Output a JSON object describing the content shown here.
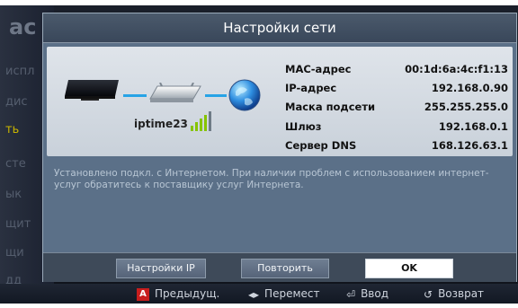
{
  "dialog": {
    "title": "Настройки сети",
    "device_name": "iptime23",
    "signal_bars": 4,
    "message": "Установлено подкл. с Интернетом. При наличии проблем с использованием интернет-услуг обратитесь к поставщику услуг Интернета.",
    "info": [
      {
        "key": "МАС-адрес",
        "value": "00:1d:6a:4c:f1:13"
      },
      {
        "key": "IP-адрес",
        "value": "192.168.0.90"
      },
      {
        "key": "Маска подсети",
        "value": "255.255.255.0"
      },
      {
        "key": "Шлюз",
        "value": "192.168.0.1"
      },
      {
        "key": "Сервер DNS",
        "value": "168.126.63.1"
      }
    ],
    "buttons": {
      "ip_settings": "Настройки IP",
      "retry": "Повторить",
      "ok": "OK"
    }
  },
  "background_menu": {
    "title_fragment": "ас",
    "items": [
      "испл",
      "дис",
      "ть",
      "сте",
      "ык",
      "щит",
      "щи",
      "дд"
    ]
  },
  "help_bar": {
    "prev_key": "A",
    "prev_label": "Предыдущ.",
    "move_label": "Перемест",
    "enter_label": "Ввод",
    "return_label": "Возврат"
  },
  "colors": {
    "accent_line": "#27a3e6",
    "signal": "#86c400",
    "key_a": "#c81d1d"
  }
}
